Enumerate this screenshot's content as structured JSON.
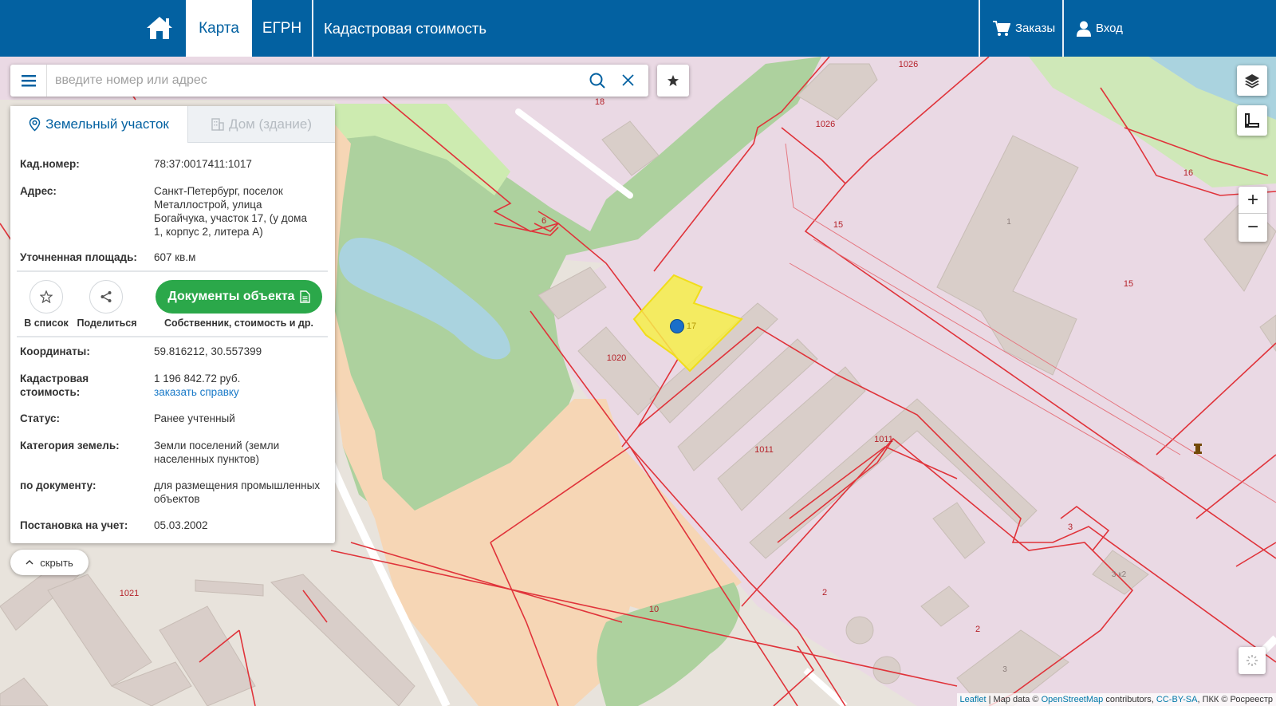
{
  "header": {
    "home_icon": "home-icon",
    "tabs": [
      {
        "label": "Карта",
        "active": true
      },
      {
        "label": "ЕГРН",
        "active": false
      },
      {
        "label": "Кадастровая стоимость",
        "active": false
      }
    ],
    "orders_label": "Заказы",
    "login_label": "Вход"
  },
  "search": {
    "placeholder": "введите номер или адрес"
  },
  "panel": {
    "tab_parcel": "Земельный участок",
    "tab_building": "Дом (здание)",
    "fields": {
      "cad_label": "Кад.номер:",
      "cad_value": "78:37:0017411:1017",
      "address_label": "Адрес:",
      "address_value": "Санкт-Петербург, поселок Металлострой, улица Богайчука, участок 17, (у дома 1, корпус 2, литера А)",
      "area_label": "Уточненная площадь:",
      "area_value": "607 кв.м",
      "coords_label": "Координаты:",
      "coords_value": "59.816212, 30.557399",
      "cost_label": "Кадастровая стоимость:",
      "cost_value": "1 196 842.72 руб.",
      "cost_link": "заказать справку",
      "status_label": "Статус:",
      "status_value": "Ранее учтенный",
      "category_label": "Категория земель:",
      "category_value": "Земли поселений (земли населенных пунктов)",
      "doc_label": "по документу:",
      "doc_value": "для размещения промышленных объектов",
      "reg_label": "Постановка на учет:",
      "reg_value": "05.03.2002"
    },
    "actions": {
      "add_list": "В список",
      "share": "Поделиться",
      "documents_button": "Документы объекта",
      "documents_sub": "Собственник, стоимость и др."
    }
  },
  "hide_label": "скрыть",
  "map_labels": {
    "l18": "18",
    "l1026a": "1026",
    "l1026b": "1026",
    "l6": "6",
    "l16": "16",
    "l15a": "15",
    "l15b": "15",
    "l1": "1",
    "l17": "17",
    "l1020": "1020",
    "l1011a": "1011",
    "l1011b": "1011",
    "l3": "3",
    "l3k2": "3 к2",
    "l1021": "1021",
    "l10": "10",
    "l2a": "2",
    "l2b": "2",
    "l3b": "3"
  },
  "attribution": {
    "leaflet": "Leaflet",
    "sep": " | Map data © ",
    "osm": "OpenStreetMap",
    "contrib": " contributors, ",
    "license": "CC-BY-SA",
    "pkk": ", ПКК © Росреестр"
  },
  "colors": {
    "header": "#0361a1",
    "selected_parcel": "#f6ed4a",
    "parcel_border": "#e0333a",
    "industrial": "#ead9e4",
    "park": "#add19e",
    "water": "#aad3df",
    "sand": "#f6d6b5"
  }
}
